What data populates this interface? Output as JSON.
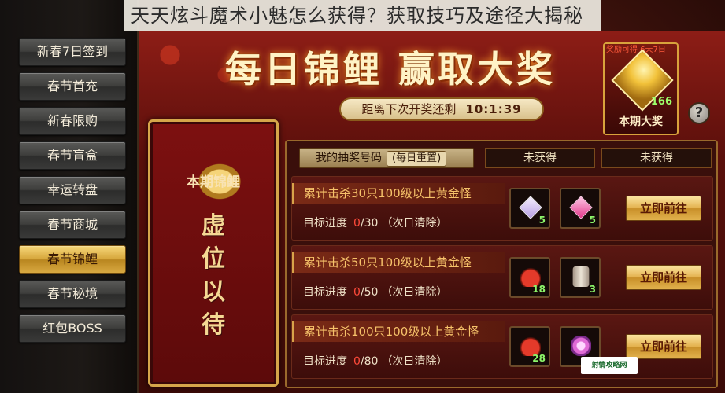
{
  "caption": "天天炫斗魔术小魅怎么获得？获取技巧及途径大揭秘",
  "sidebar": {
    "items": [
      {
        "label": "新春7日签到"
      },
      {
        "label": "春节首充"
      },
      {
        "label": "新春限购"
      },
      {
        "label": "春节盲盒"
      },
      {
        "label": "幸运转盘"
      },
      {
        "label": "春节商城"
      },
      {
        "label": "春节锦鲤",
        "active": true
      },
      {
        "label": "春节秘境"
      },
      {
        "label": "红包BOSS"
      }
    ]
  },
  "banner": {
    "title": "每日锦鲤 赢取大奖"
  },
  "countdown": {
    "label": "距离下次开奖还剩",
    "time": "10:1:39"
  },
  "grand_prize": {
    "note": "奖励可得 6天7日",
    "count": "166",
    "label": "本期大奖"
  },
  "help": {
    "label": "?"
  },
  "koi_panel": {
    "title": "本期锦鲤",
    "placeholder": "虚位以待"
  },
  "lottery": {
    "label": "我的抽奖号码",
    "tag": "(每日重置)",
    "slots": [
      "未获得",
      "未获得"
    ]
  },
  "tasks": [
    {
      "name": "累计击杀30只100级以上黄金怪",
      "progress_label": "目标进度",
      "current": "0",
      "target": "/30",
      "note": "（次日清除）",
      "rewards": [
        {
          "icon": "crystal-icon",
          "count": "5"
        },
        {
          "icon": "pink-gem-icon",
          "count": "5"
        }
      ],
      "button": "立即前往"
    },
    {
      "name": "累计击杀50只100级以上黄金怪",
      "progress_label": "目标进度",
      "current": "0",
      "target": "/50",
      "note": "（次日清除）",
      "rewards": [
        {
          "icon": "red-pouch-icon",
          "count": "18"
        },
        {
          "icon": "ore-icon",
          "count": "3"
        }
      ],
      "button": "立即前往"
    },
    {
      "name": "累计击杀100只100级以上黄金怪",
      "progress_label": "目标进度",
      "current": "0",
      "target": "/80",
      "note": "（次日清除）",
      "rewards": [
        {
          "icon": "red-pouch-icon",
          "count": "28"
        },
        {
          "icon": "lilac-gem-icon",
          "count": ""
        }
      ],
      "button": "立即前往"
    }
  ],
  "watermark": "射情攻略网"
}
